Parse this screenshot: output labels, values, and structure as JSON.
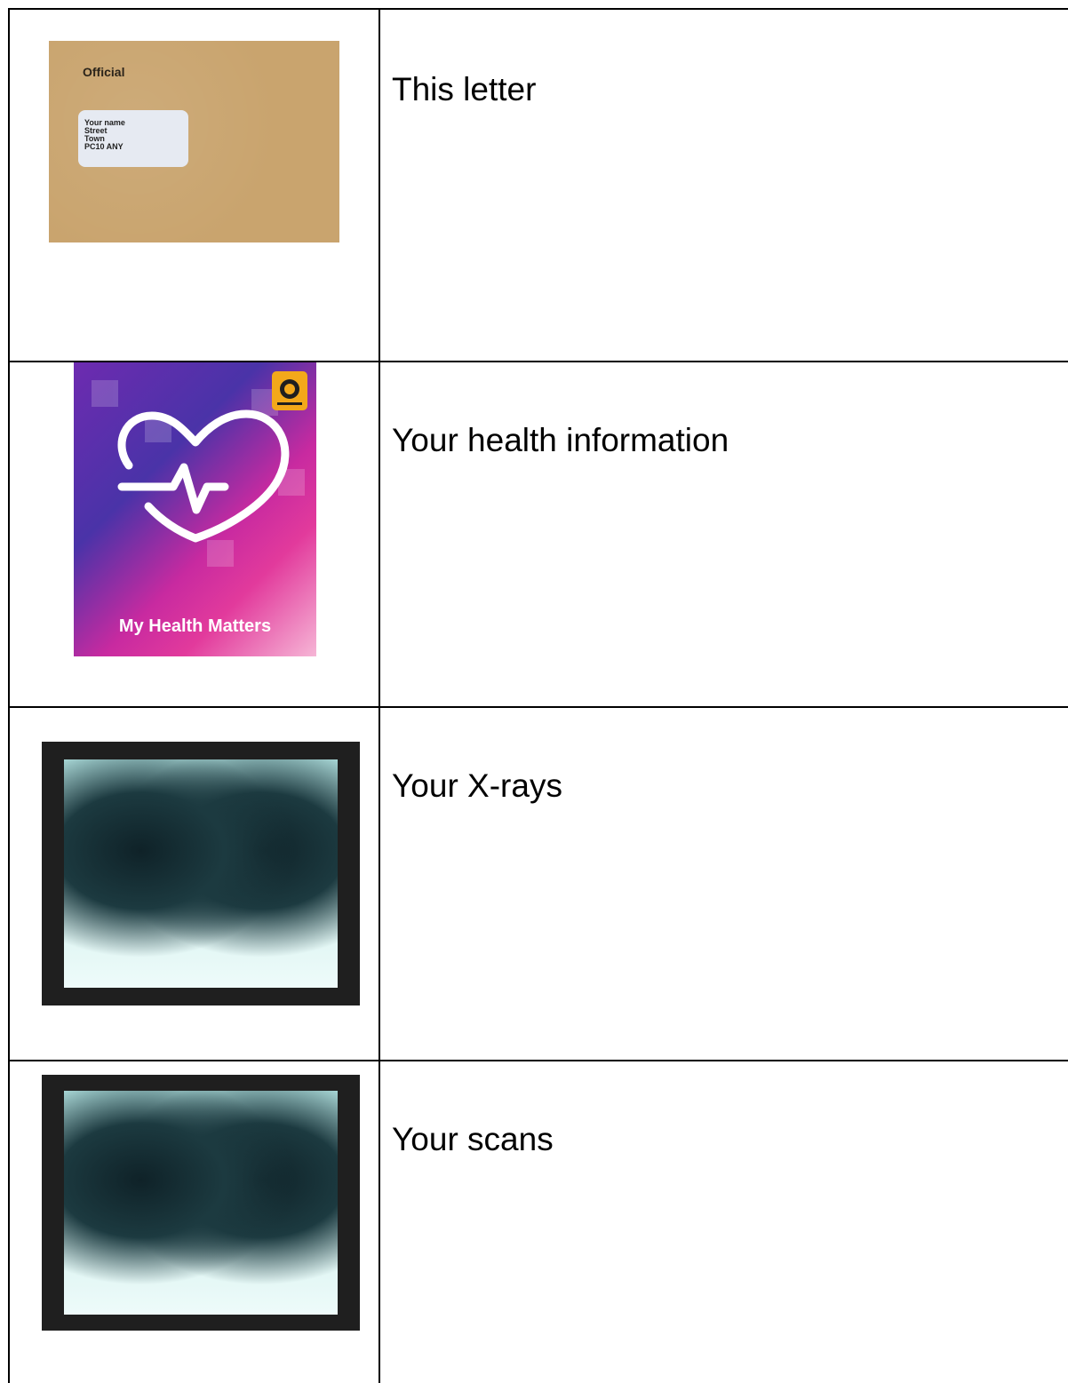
{
  "rows": [
    {
      "label": "This letter",
      "envelope": {
        "heading": "Official",
        "address_lines": [
          "Your name",
          "Street",
          "Town",
          "PC10 ANY"
        ]
      }
    },
    {
      "label": "Your health information",
      "booklet": {
        "title": "My Health Matters"
      }
    },
    {
      "label": "Your X-rays"
    },
    {
      "label": "Your scans"
    }
  ],
  "icons": {
    "row2": "heart-rate-icon",
    "row2_badge": "badge-icon"
  },
  "colors": {
    "envelope": "#c9a46e",
    "border": "#000000",
    "xray_frame": "#1f1f1f"
  }
}
